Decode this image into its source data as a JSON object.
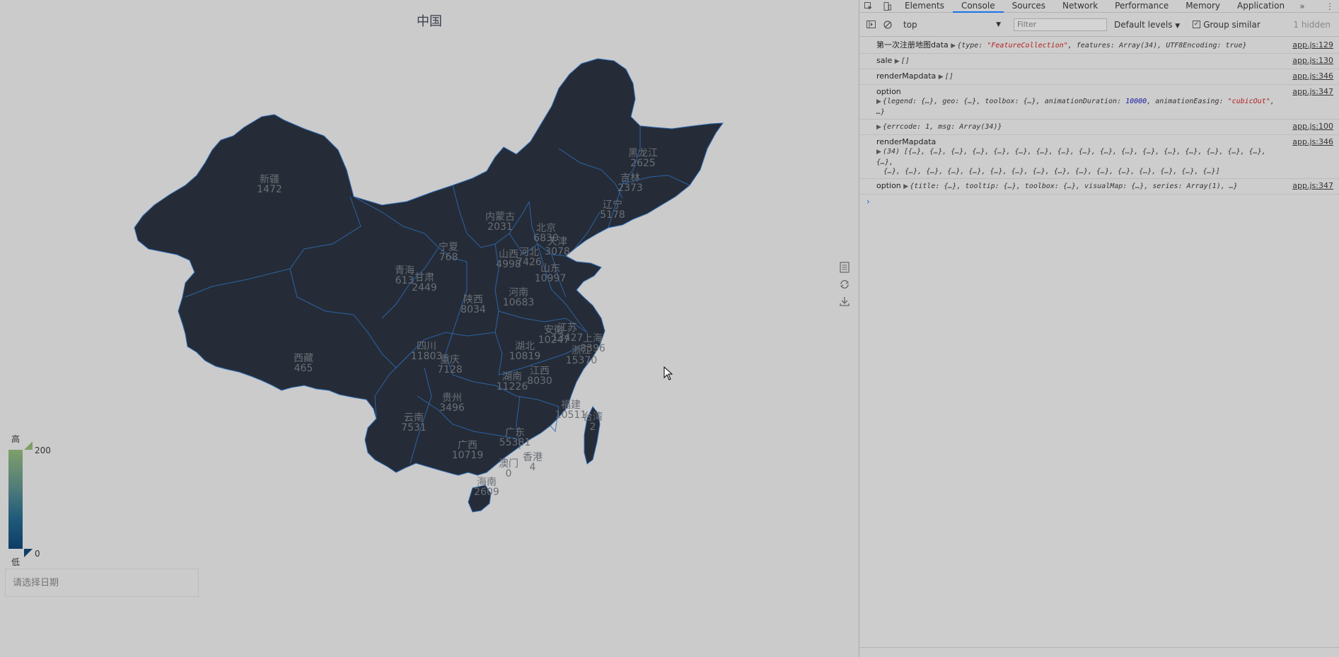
{
  "map": {
    "title": "中国",
    "provinces": [
      {
        "name": "黑龙江",
        "value": "2625"
      },
      {
        "name": "吉林",
        "value": "2373"
      },
      {
        "name": "辽宁",
        "value": "5178"
      },
      {
        "name": "新疆",
        "value": "1472"
      },
      {
        "name": "内蒙古",
        "value": "2031"
      },
      {
        "name": "北京",
        "value": "6830"
      },
      {
        "name": "宁夏",
        "value": "768"
      },
      {
        "name": "山西",
        "value": "4998"
      },
      {
        "name": "河北",
        "value": "7426"
      },
      {
        "name": "天津",
        "value": "3078"
      },
      {
        "name": "青海",
        "value": "613"
      },
      {
        "name": "甘肃",
        "value": "2449"
      },
      {
        "name": "山东",
        "value": "10997"
      },
      {
        "name": "陕西",
        "value": "8034"
      },
      {
        "name": "河南",
        "value": "10683"
      },
      {
        "name": "安徽",
        "value": "10247"
      },
      {
        "name": "江苏",
        "value": "13427"
      },
      {
        "name": "上海",
        "value": "8396"
      },
      {
        "name": "四川",
        "value": "11803"
      },
      {
        "name": "湖北",
        "value": "10819"
      },
      {
        "name": "浙江",
        "value": "15370"
      },
      {
        "name": "西藏",
        "value": "465"
      },
      {
        "name": "重庆",
        "value": "7128"
      },
      {
        "name": "湖南",
        "value": "11226"
      },
      {
        "name": "江西",
        "value": "8030"
      },
      {
        "name": "贵州",
        "value": "3496"
      },
      {
        "name": "福建",
        "value": "10511"
      },
      {
        "name": "台湾",
        "value": "2"
      },
      {
        "name": "云南",
        "value": "7531"
      },
      {
        "name": "广东",
        "value": "55381"
      },
      {
        "name": "广西",
        "value": "10719"
      },
      {
        "name": "澳门",
        "value": "0"
      },
      {
        "name": "香港",
        "value": "4"
      },
      {
        "name": "海南",
        "value": "2609"
      }
    ]
  },
  "visual_map": {
    "high_label": "高",
    "low_label": "低",
    "max": "200",
    "min": "0",
    "colors": [
      "#7f9f6a",
      "#0e3d66"
    ]
  },
  "date_input": {
    "placeholder": "请选择日期"
  },
  "toolbox": {
    "icons": [
      "data-view-icon",
      "refresh-icon",
      "download-icon"
    ]
  },
  "devtools": {
    "tabs": [
      "Elements",
      "Console",
      "Sources",
      "Network",
      "Performance",
      "Memory",
      "Application"
    ],
    "active_tab": "Console",
    "context": "top",
    "filter_placeholder": "Filter",
    "levels": "Default levels",
    "group_similar": "Group similar",
    "hidden": "1 hidden",
    "logs": [
      {
        "label": "第一次注册地图data",
        "obj_pre": "{type: ",
        "obj_str": "\"FeatureCollection\"",
        "obj_post": ", features: Array(34), UTF8Encoding: true}",
        "src": "app.js:129"
      },
      {
        "label": "sale",
        "obj": "[]",
        "src": "app.js:130"
      },
      {
        "label": "renderMapdata",
        "obj": "[]",
        "src": "app.js:346"
      },
      {
        "label": "option",
        "obj_pre": "{legend: {…}, geo: {…}, toolbox: {…}, animationDuration: ",
        "obj_num": "10000",
        "obj_mid": ", animationEasing: ",
        "obj_str": "\"cubicOut\"",
        "obj_post": ", …}",
        "src": "app.js:347"
      },
      {
        "label": "",
        "obj": "{errcode: 1, msg: Array(34)}",
        "src": "app.js:100"
      },
      {
        "label": "renderMapdata",
        "line1": "(34) [{…}, {…}, {…}, {…}, {…}, {…}, {…}, {…}, {…}, {…}, {…}, {…}, {…}, {…}, {…}, {…}, {…}, {…},",
        "line2": "{…}, {…}, {…}, {…}, {…}, {…}, {…}, {…}, {…}, {…}, {…}, {…}, {…}, {…}, {…}, {…}]",
        "src": "app.js:346"
      },
      {
        "label": "option",
        "obj": "{title: {…}, tooltip: {…}, toolbox: {…}, visualMap: {…}, series: Array(1), …}",
        "src": "app.js:347"
      }
    ]
  }
}
